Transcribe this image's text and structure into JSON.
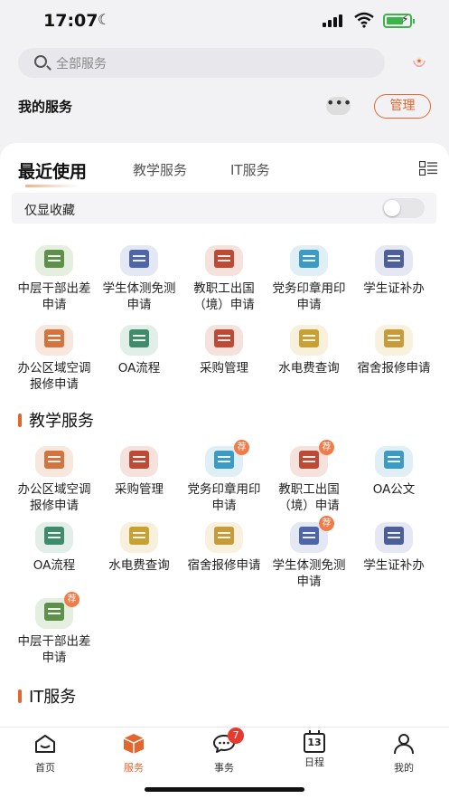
{
  "status_bar": {
    "time": "17:07"
  },
  "search": {
    "placeholder": "全部服务"
  },
  "my_services": {
    "title": "我的服务",
    "more": "•••",
    "manage": "管理"
  },
  "tabs": [
    {
      "label": "最近使用",
      "active": true
    },
    {
      "label": "教学服务",
      "active": false
    },
    {
      "label": "IT服务",
      "active": false
    }
  ],
  "favorites_toggle": {
    "label": "仅显收藏",
    "on": false
  },
  "recent": [
    {
      "label": "中层干部出差申请",
      "icon": "business-trip-icon",
      "color": "green"
    },
    {
      "label": "学生体测免测申请",
      "icon": "fitness-test-icon",
      "color": "blue"
    },
    {
      "label": "教职工出国（境）申请",
      "icon": "flight-icon",
      "color": "red"
    },
    {
      "label": "党务印章用印申请",
      "icon": "seal-icon",
      "color": "cyan"
    },
    {
      "label": "学生证补办",
      "icon": "student-card-icon",
      "color": "navy"
    },
    {
      "label": "办公区域空调报修申请",
      "icon": "repair-icon",
      "color": "orange"
    },
    {
      "label": "OA流程",
      "icon": "workflow-icon",
      "color": "teal"
    },
    {
      "label": "采购管理",
      "icon": "purchase-icon",
      "color": "red"
    },
    {
      "label": "水电费查询",
      "icon": "lightning-icon",
      "color": "amber"
    },
    {
      "label": "宿舍报修申请",
      "icon": "dormitory-icon",
      "color": "yellow"
    }
  ],
  "teaching_section": {
    "title": "教学服务"
  },
  "teaching": [
    {
      "label": "办公区域空调报修申请",
      "icon": "repair-icon",
      "color": "orange"
    },
    {
      "label": "采购管理",
      "icon": "purchase-icon",
      "color": "red"
    },
    {
      "label": "党务印章用印申请",
      "icon": "seal-icon",
      "color": "cyan",
      "badge": "荐"
    },
    {
      "label": "教职工出国（境）申请",
      "icon": "flight-icon",
      "color": "red",
      "badge": "荐"
    },
    {
      "label": "OA公文",
      "icon": "document-icon",
      "color": "cyan"
    },
    {
      "label": "OA流程",
      "icon": "workflow-icon",
      "color": "teal"
    },
    {
      "label": "水电费查询",
      "icon": "lightning-icon",
      "color": "amber"
    },
    {
      "label": "宿舍报修申请",
      "icon": "dormitory-icon",
      "color": "yellow"
    },
    {
      "label": "学生体测免测申请",
      "icon": "fitness-test-icon",
      "color": "blue",
      "badge": "荐"
    },
    {
      "label": "学生证补办",
      "icon": "student-card-icon",
      "color": "navy"
    },
    {
      "label": "中层干部出差申请",
      "icon": "business-trip-icon",
      "color": "green",
      "badge": "荐"
    }
  ],
  "it_section": {
    "title": "IT服务"
  },
  "nav": [
    {
      "label": "首页",
      "icon": "home-icon",
      "active": false
    },
    {
      "label": "服务",
      "icon": "service-cube-icon",
      "active": true
    },
    {
      "label": "事务",
      "icon": "chat-icon",
      "active": false,
      "badge": "7"
    },
    {
      "label": "日程",
      "icon": "calendar-icon",
      "active": false,
      "day": "13"
    },
    {
      "label": "我的",
      "icon": "user-icon",
      "active": false
    }
  ],
  "accent_color": "#e2672f"
}
